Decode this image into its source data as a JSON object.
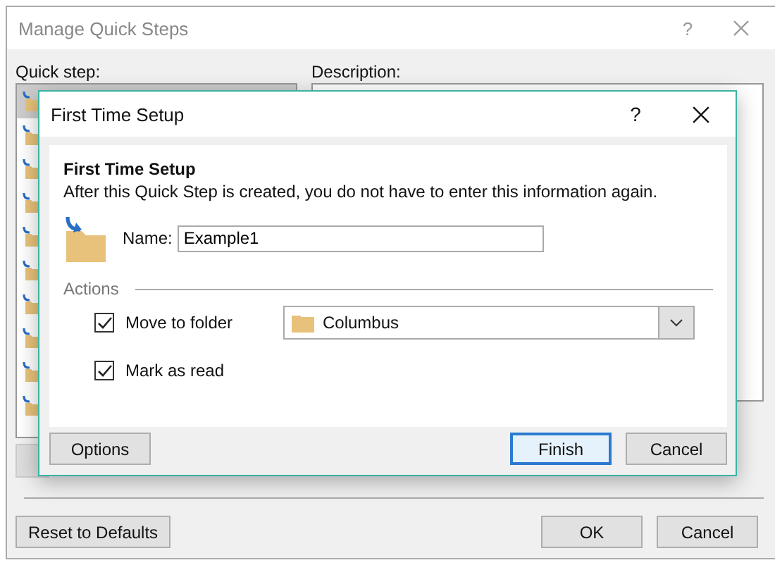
{
  "manage_dialog": {
    "title": "Manage Quick Steps",
    "help": "?",
    "active": false,
    "quick_step_label": "Quick step:",
    "description_label": "Description:",
    "quick_steps": [
      {
        "selected": true
      },
      {
        "selected": false
      },
      {
        "selected": false
      },
      {
        "selected": false
      },
      {
        "selected": false
      },
      {
        "selected": false
      },
      {
        "selected": false
      },
      {
        "selected": false
      },
      {
        "selected": false
      },
      {
        "selected": false
      }
    ],
    "reset_button": "Reset to Defaults",
    "buttons": [
      {
        "label": "OK"
      },
      {
        "label": "Cancel"
      }
    ]
  },
  "setup_dialog": {
    "title": "First Time Setup",
    "help": "?",
    "active": true,
    "heading": "First Time Setup",
    "description": "After this Quick Step is created, you do not have to enter this information again.",
    "name_label": "Name:",
    "name_value": "Example1",
    "actions_label": "Actions",
    "actions": [
      {
        "label": "Move to folder",
        "checked": true,
        "folder": "Columbus"
      },
      {
        "label": "Mark as read",
        "checked": true
      }
    ],
    "options_button": "Options",
    "buttons": [
      {
        "label": "Finish",
        "default": true
      },
      {
        "label": "Cancel",
        "default": false
      }
    ]
  }
}
